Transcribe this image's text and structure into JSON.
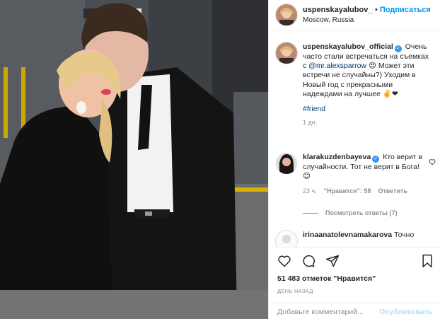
{
  "header": {
    "username": "uspenskayalubov_official",
    "separator": "•",
    "follow_label": "Подписаться",
    "location": "Moscow, Russia"
  },
  "caption": {
    "username": "uspenskayalubov_official",
    "verified_mark": "✓",
    "text_1": "Очень часто стали встречаться на съемках с",
    "mention": "@mr.alexsparrow",
    "text_2": "😍 Может эти встречи не случайны?) Уходим в Новый год с прекрасными надеждами на лучшее ✌️❤",
    "hashtag": "#friend",
    "time": "1 дн."
  },
  "comments": [
    {
      "username": "klarakuzdenbayeva",
      "verified_mark": "✓",
      "text": "Кто верит в случайности. Тот не верит в Бога!😊",
      "time": "23 ч.",
      "likes": "\"Нравится\": 58",
      "reply_label": "Ответить",
      "view_replies": "Посмотреть ответы (7)"
    },
    {
      "username": "irinaanatolevnamakarova",
      "text": "Точно"
    }
  ],
  "actions": {
    "likes_count": "51 483 отметок \"Нравится\"",
    "time_ago": "ДЕНЬ НАЗАД",
    "comment_placeholder": "Добавьте комментарий...",
    "publish_label": "Опубликовать"
  },
  "icons": [
    "heart-icon",
    "comment-icon",
    "share-icon",
    "bookmark-icon"
  ],
  "colors": {
    "accent": "#0095f6",
    "muted": "#8e8e8e",
    "publish_disabled": "#b2dffc",
    "verified": "#3897f0"
  }
}
